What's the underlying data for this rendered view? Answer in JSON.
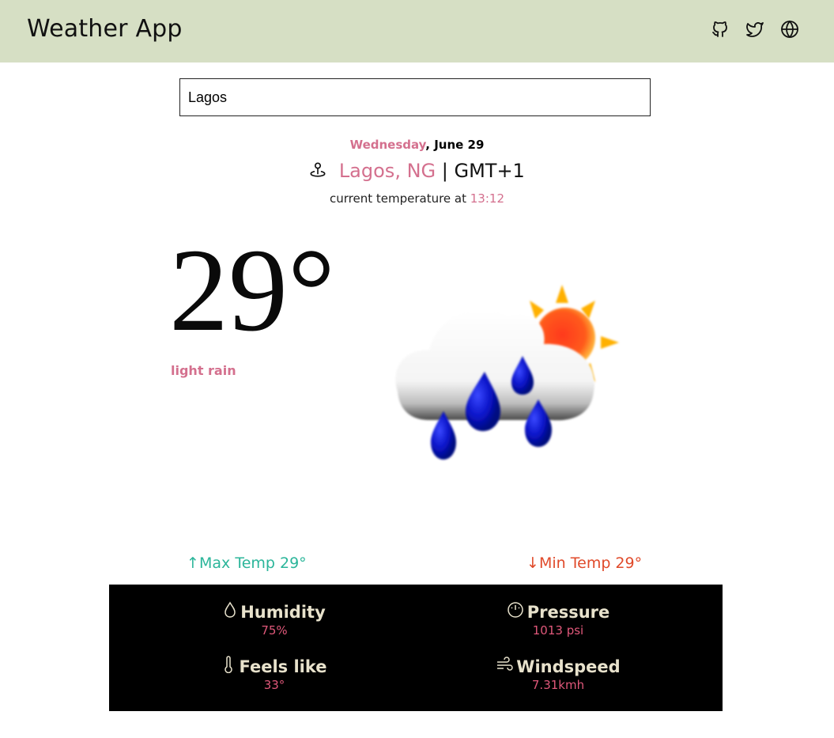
{
  "app": {
    "title": "Weather App"
  },
  "header": {
    "icons": [
      "github-icon",
      "twitter-icon",
      "globe-icon"
    ]
  },
  "search": {
    "value": "Lagos",
    "placeholder": ""
  },
  "date": {
    "day": "Wednesday",
    "rest": ", June 29"
  },
  "location": {
    "city": "Lagos, NG",
    "timezone": "| GMT+1",
    "icon": "location-pin-icon"
  },
  "current": {
    "prefix": "current temperature at ",
    "time": "13:12"
  },
  "weather": {
    "temperature": "29°",
    "description": "light rain",
    "icon": "cloud-rain-sun-icon",
    "max_temp": "Max Temp 29°",
    "min_temp": "Min Temp 29°"
  },
  "stats": {
    "humidity": {
      "label": "Humidity",
      "value": "75%",
      "icon": "droplet-icon"
    },
    "pressure": {
      "label": "Pressure",
      "value": "1013 psi",
      "icon": "gauge-icon"
    },
    "feels_like": {
      "label": "Feels like",
      "value": "33°",
      "icon": "thermometer-icon"
    },
    "windspeed": {
      "label": "Windspeed",
      "value": "7.31kmh",
      "icon": "wind-icon"
    }
  },
  "colors": {
    "header_bg": "#d6dfc4",
    "accent": "#d4708e",
    "max": "#2bb59a",
    "min": "#e04a2a",
    "panel_bg": "#000000",
    "panel_label": "#e8e2cc",
    "panel_value": "#e0587a"
  }
}
